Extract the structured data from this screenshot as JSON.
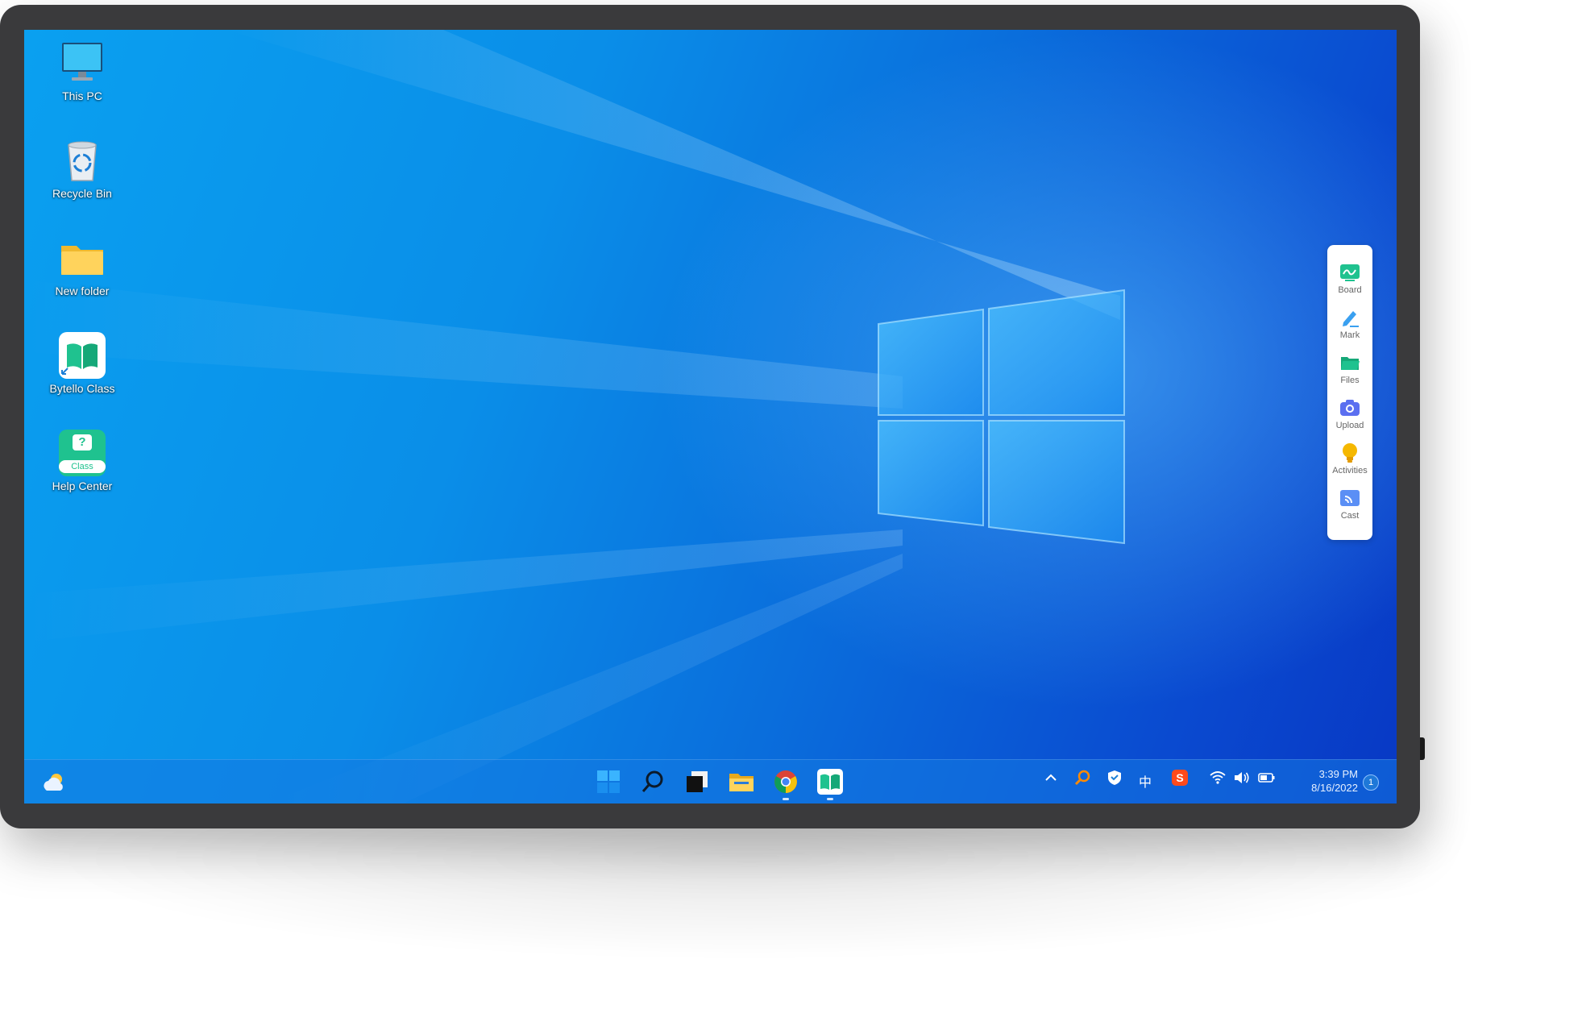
{
  "desktop": {
    "icons": [
      {
        "label": "This PC",
        "icon": "this-pc-icon"
      },
      {
        "label": "Recycle Bin",
        "icon": "recycle-bin-icon"
      },
      {
        "label": "New folder",
        "icon": "folder-icon"
      },
      {
        "label": "Bytello Class",
        "icon": "bytello-class-icon"
      },
      {
        "label": "Help Center",
        "icon": "help-center-icon",
        "badge": "Class",
        "glyph": "?"
      }
    ]
  },
  "toolbar": {
    "items": [
      {
        "label": "Board",
        "icon": "board-icon",
        "color": "#1fc28f"
      },
      {
        "label": "Mark",
        "icon": "pen-icon",
        "color": "#3aa0f0"
      },
      {
        "label": "Files",
        "icon": "files-icon",
        "color": "#1fc28f"
      },
      {
        "label": "Upload",
        "icon": "camera-icon",
        "color": "#5b6ff0"
      },
      {
        "label": "Activities",
        "icon": "bulb-icon",
        "color": "#f5b800"
      },
      {
        "label": "Cast",
        "icon": "cast-icon",
        "color": "#5b8ff5"
      }
    ]
  },
  "taskbar": {
    "apps": [
      "weather-icon",
      "start-icon",
      "search-icon",
      "task-view-icon",
      "file-explorer-icon",
      "chrome-icon",
      "bytello-class-icon"
    ],
    "tray": {
      "ime": "中",
      "time": "3:39 PM",
      "date": "8/16/2022",
      "notification_count": "1"
    }
  },
  "colors": {
    "accent": "#0a78e6",
    "bytello_green": "#1fc28f"
  }
}
